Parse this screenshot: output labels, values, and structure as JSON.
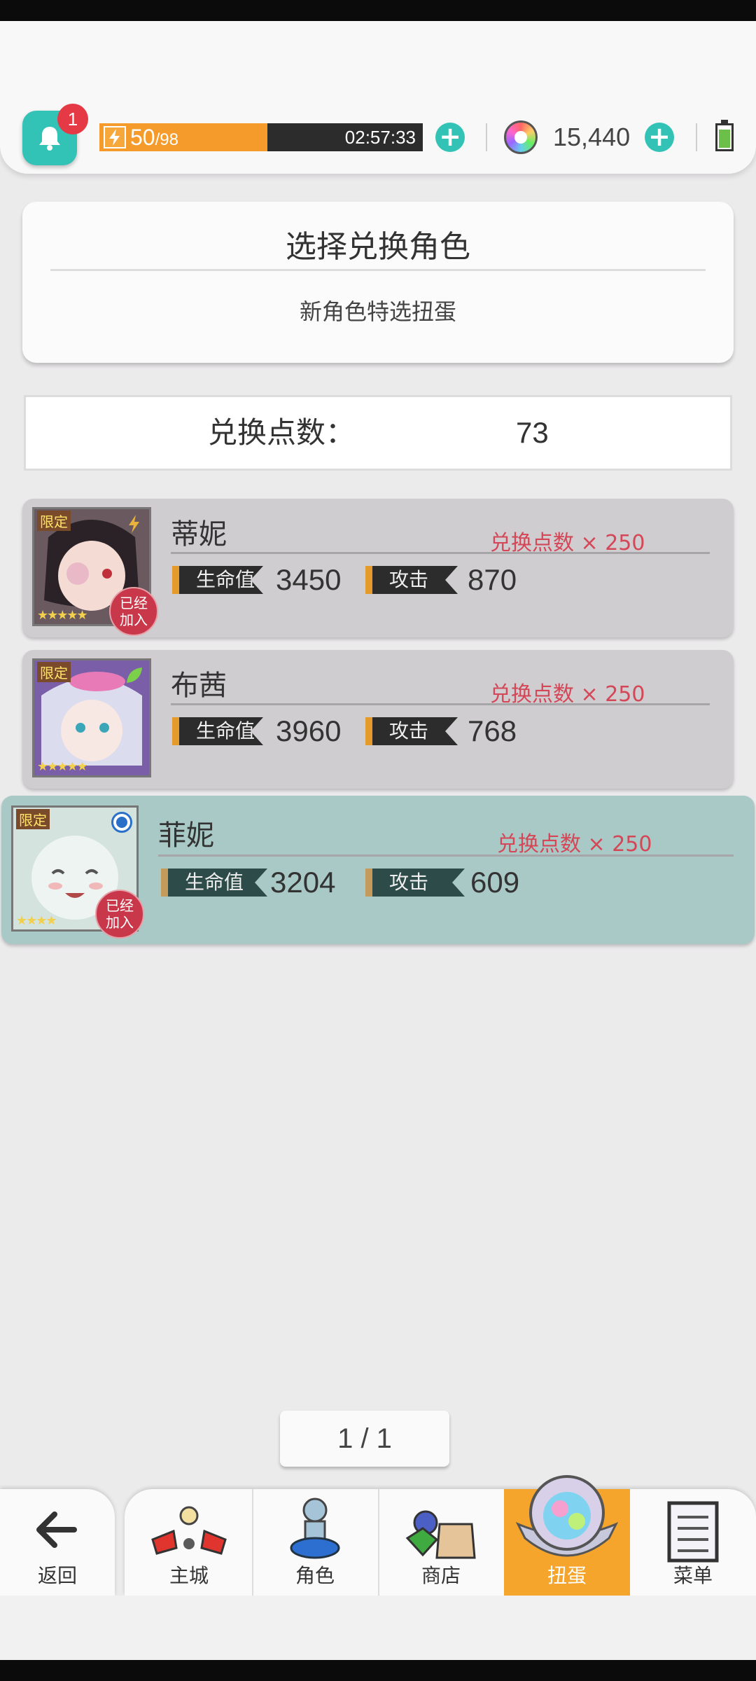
{
  "header": {
    "notification_count": "1",
    "stamina_current": "50",
    "stamina_max": "/98",
    "stamina_fraction": 0.52,
    "stamina_timer": "02:57:33",
    "gem_count": "15,440"
  },
  "title_card": {
    "title": "选择兑换角色",
    "subtitle": "新角色特选扭蛋"
  },
  "points": {
    "label": "兑换点数：",
    "value": "73"
  },
  "characters": [
    {
      "name": "蒂妮",
      "cost": "兑换点数 × 250",
      "hp_label": "生命值",
      "hp": "3450",
      "atk_label": "攻击",
      "atk": "870",
      "tag": "限定",
      "stars": "★★★★★",
      "joined": "已经加入"
    },
    {
      "name": "布茜",
      "cost": "兑换点数 × 250",
      "hp_label": "生命值",
      "hp": "3960",
      "atk_label": "攻击",
      "atk": "768",
      "tag": "限定",
      "stars": "★★★★★"
    },
    {
      "name": "菲妮",
      "cost": "兑换点数 × 250",
      "hp_label": "生命值",
      "hp": "3204",
      "atk_label": "攻击",
      "atk": "609",
      "tag": "限定",
      "stars": "★★★★",
      "joined": "已经加入"
    }
  ],
  "pager": {
    "text": "1 / 1"
  },
  "nav": {
    "back": "返回",
    "items": [
      "主城",
      "角色",
      "商店",
      "扭蛋",
      "菜单"
    ]
  }
}
